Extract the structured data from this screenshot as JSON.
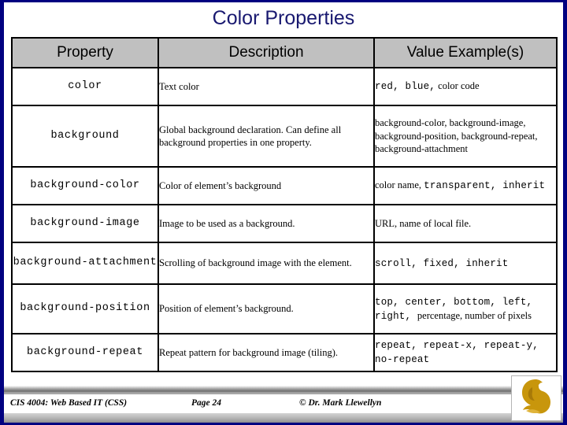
{
  "slide": {
    "title": "Color Properties",
    "title_color": "#191970",
    "border_color": "#000080",
    "header_bg": "#c0c0c0"
  },
  "table": {
    "headers": [
      "Property",
      "Description",
      "Value Example(s)"
    ],
    "rows": [
      {
        "property": "color",
        "description": "Text color",
        "value_mono_1": "red, blue,",
        "value_serif_1": " color code",
        "value_mono_2": "",
        "value_serif_2": ""
      },
      {
        "property": "background",
        "description": "Global background declaration.  Can define all background properties in one property.",
        "value_mono_1": "",
        "value_serif_1": "background-color, background-image, background-position, background-repeat, background-attachment",
        "value_mono_2": "",
        "value_serif_2": ""
      },
      {
        "property": "background-color",
        "description": "Color of element’s background",
        "value_mono_1": "",
        "value_serif_1": "color name, ",
        "value_mono_2": "transparent, inherit",
        "value_serif_2": ""
      },
      {
        "property": "background-image",
        "description": "Image to be used as a background.",
        "value_mono_1": "",
        "value_serif_1": "URL, name of local file.",
        "value_mono_2": "",
        "value_serif_2": ""
      },
      {
        "property": "background-attachment",
        "description": "Scrolling of background image with the element.",
        "value_mono_1": "scroll, fixed, inherit",
        "value_serif_1": "",
        "value_mono_2": "",
        "value_serif_2": ""
      },
      {
        "property": "background-position",
        "description": "Position of element’s background.",
        "value_mono_1": "top, center, bottom, left, right, ",
        "value_serif_1": "percentage, number of pixels",
        "value_mono_2": "",
        "value_serif_2": ""
      },
      {
        "property": "background-repeat",
        "description": "Repeat pattern for background image (tiling).",
        "value_mono_1": "repeat, repeat-x, repeat-y, no-repeat",
        "value_serif_1": "",
        "value_mono_2": "",
        "value_serif_2": ""
      }
    ]
  },
  "footer": {
    "course": "CIS 4004: Web Based IT (CSS)",
    "page": "Page 24",
    "copyright": "© Dr. Mark Llewellyn",
    "logo_color": "#c8960c"
  }
}
